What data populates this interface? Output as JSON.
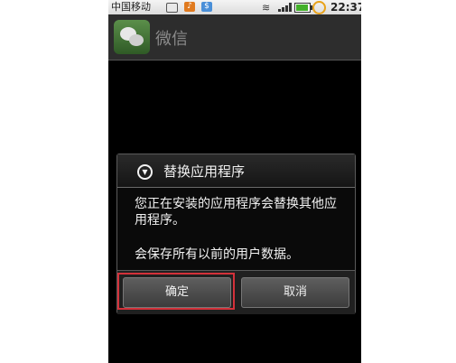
{
  "statusbar": {
    "carrier": "中国移动",
    "time": "22:37",
    "icons": [
      "message-icon",
      "app-notification-icon",
      "app-notification-icon",
      "wifi-icon",
      "signal-icon",
      "battery-icon",
      "alarm-icon"
    ],
    "battery_level": 0.9
  },
  "app": {
    "title": "微信",
    "icon": "wechat-icon"
  },
  "dialog": {
    "title": "替换应用程序",
    "message": "您正在安装的应用程序会替换其他应用程序。",
    "message2": "会保存所有以前的用户数据。",
    "ok_label": "确定",
    "cancel_label": "取消"
  },
  "colors": {
    "highlight": "#d3313a",
    "background": "#000000"
  }
}
